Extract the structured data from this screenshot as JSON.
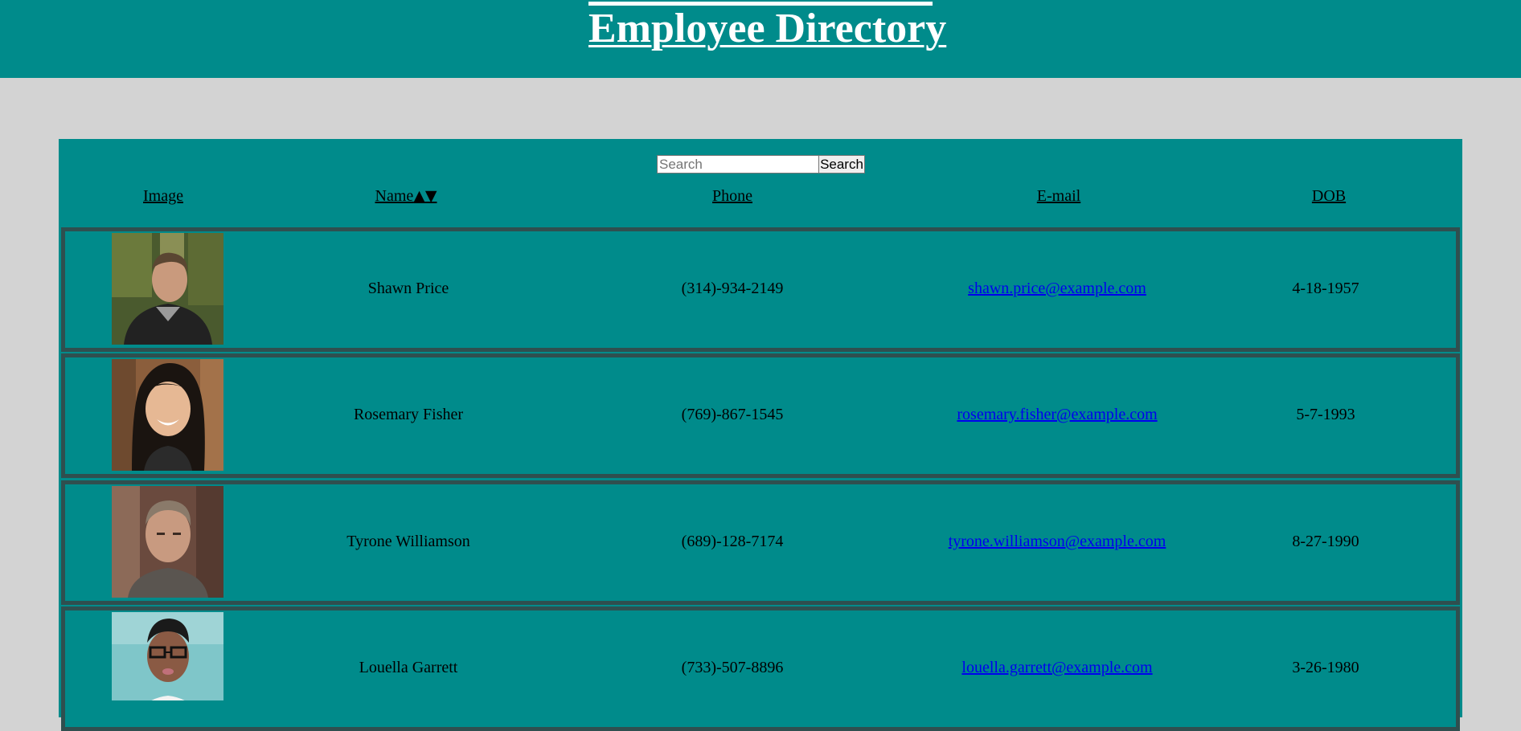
{
  "header": {
    "title": "Employee Directory"
  },
  "search": {
    "placeholder": "Search",
    "value": "",
    "button_label": "Search"
  },
  "columns": {
    "image": "Image",
    "name": "Name",
    "name_sort_icons": "▲▼",
    "phone": "Phone",
    "email": "E-mail",
    "dob": "DOB"
  },
  "employees": [
    {
      "name": "Shawn Price",
      "phone": "(314)-934-2149",
      "email": "shawn.price@example.com",
      "dob": "4-18-1957"
    },
    {
      "name": "Rosemary Fisher",
      "phone": "(769)-867-1545",
      "email": "rosemary.fisher@example.com",
      "dob": "5-7-1993"
    },
    {
      "name": "Tyrone Williamson",
      "phone": "(689)-128-7174",
      "email": "tyrone.williamson@example.com",
      "dob": "8-27-1990"
    },
    {
      "name": "Louella Garrett",
      "phone": "(733)-507-8896",
      "email": "louella.garrett@example.com",
      "dob": "3-26-1980"
    }
  ],
  "colors": {
    "header_bg": "#008b8b",
    "page_bg": "#d3d3d3",
    "row_border": "#2f4f4f",
    "link": "#0000ee"
  }
}
